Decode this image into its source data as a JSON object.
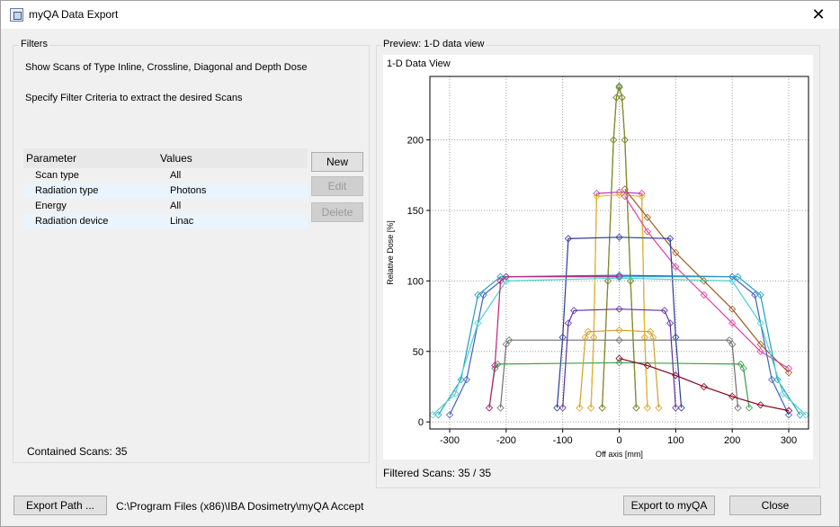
{
  "window": {
    "title": "myQA Data Export",
    "close_label": "✕"
  },
  "filters": {
    "group_label": "Filters",
    "line1": "Show Scans of Type Inline, Crossline, Diagonal and Depth Dose",
    "line2": "Specify Filter Criteria to extract the desired Scans",
    "table": {
      "headers": [
        "Parameter",
        "Values"
      ],
      "rows": [
        {
          "parameter": "Scan type",
          "value": "All"
        },
        {
          "parameter": "Radiation type",
          "value": "Photons"
        },
        {
          "parameter": "Energy",
          "value": "All"
        },
        {
          "parameter": "Radiation device",
          "value": "Linac"
        }
      ]
    },
    "buttons": {
      "new": "New",
      "edit": "Edit",
      "delete": "Delete"
    },
    "contained_scans": "Contained Scans: 35"
  },
  "preview": {
    "group_label": "Preview: 1-D data view",
    "filtered_scans": "Filtered Scans: 35 / 35"
  },
  "footer": {
    "export_path_label": "Export Path ...",
    "path": "C:\\Program Files (x86)\\IBA Dosimetry\\myQA Accept",
    "export_button": "Export to myQA",
    "close_button": "Close"
  },
  "chart_data": {
    "type": "line",
    "title": "1-D Data View",
    "xlabel": "Off axis [mm]",
    "ylabel": "Relative Dose [%]",
    "xlim": [
      -335,
      335
    ],
    "ylim": [
      -5,
      245
    ],
    "xticks": [
      -300,
      -200,
      -100,
      0,
      100,
      200,
      300
    ],
    "yticks": [
      0,
      50,
      100,
      150,
      200
    ],
    "grid": true,
    "series": [
      {
        "color": "#2a7f3a",
        "x": [
          -30,
          -20,
          -10,
          -5,
          0,
          5,
          10,
          20,
          30
        ],
        "y": [
          10,
          100,
          200,
          230,
          238,
          230,
          200,
          100,
          10
        ]
      },
      {
        "color": "#8c8a2a",
        "x": [
          -30,
          -20,
          -10,
          -5,
          0,
          5,
          10,
          20,
          30
        ],
        "y": [
          10,
          100,
          200,
          230,
          237,
          230,
          200,
          100,
          10
        ]
      },
      {
        "color": "#c040c0",
        "x": [
          -50,
          -45,
          -40,
          0,
          40,
          45,
          50
        ],
        "y": [
          10,
          60,
          162,
          163,
          162,
          60,
          10
        ]
      },
      {
        "color": "#e0c020",
        "x": [
          -50,
          -45,
          -40,
          0,
          40,
          45,
          50
        ],
        "y": [
          10,
          60,
          160,
          161,
          160,
          60,
          10
        ]
      },
      {
        "color": "#a05a20",
        "x": [
          10,
          50,
          100,
          150,
          200,
          250,
          300
        ],
        "y": [
          165,
          145,
          120,
          100,
          80,
          55,
          35
        ]
      },
      {
        "color": "#e040a0",
        "x": [
          10,
          50,
          100,
          150,
          200,
          250,
          300
        ],
        "y": [
          160,
          135,
          110,
          90,
          70,
          50,
          38
        ]
      },
      {
        "color": "#2a3a9a",
        "x": [
          -110,
          -100,
          -90,
          0,
          90,
          100,
          110
        ],
        "y": [
          10,
          60,
          130,
          131,
          130,
          60,
          10
        ]
      },
      {
        "color": "#4060c0",
        "x": [
          -300,
          -270,
          -240,
          -200,
          0,
          200,
          240,
          270,
          300
        ],
        "y": [
          5,
          30,
          90,
          103,
          104,
          103,
          90,
          30,
          5
        ]
      },
      {
        "color": "#20a0c0",
        "x": [
          -320,
          -280,
          -250,
          -210,
          0,
          210,
          250,
          280,
          320
        ],
        "y": [
          5,
          30,
          90,
          103,
          103,
          103,
          90,
          30,
          5
        ]
      },
      {
        "color": "#50d0d0",
        "x": [
          -330,
          -290,
          -250,
          -200,
          0,
          200,
          250,
          290,
          330
        ],
        "y": [
          5,
          20,
          70,
          100,
          102,
          100,
          70,
          20,
          5
        ]
      },
      {
        "color": "#707070",
        "x": [
          -210,
          -200,
          -195,
          0,
          195,
          200,
          210
        ],
        "y": [
          10,
          55,
          58,
          58,
          58,
          55,
          10
        ]
      },
      {
        "color": "#3aa04a",
        "x": [
          -230,
          -220,
          -215,
          0,
          215,
          220,
          230
        ],
        "y": [
          10,
          38,
          41,
          42,
          41,
          38,
          10
        ]
      },
      {
        "color": "#d0a020",
        "x": [
          -70,
          -60,
          -55,
          0,
          55,
          60,
          70
        ],
        "y": [
          10,
          60,
          64,
          65,
          64,
          60,
          10
        ]
      },
      {
        "color": "#6030a0",
        "x": [
          -100,
          -90,
          -80,
          0,
          80,
          90,
          100
        ],
        "y": [
          10,
          70,
          79,
          80,
          79,
          70,
          10
        ]
      },
      {
        "color": "#800020",
        "x": [
          0,
          50,
          100,
          150,
          200,
          250,
          300
        ],
        "y": [
          45,
          40,
          33,
          25,
          18,
          12,
          8
        ]
      },
      {
        "color": "#c02080",
        "x": [
          -230,
          -220,
          -210,
          -200,
          0
        ],
        "y": [
          10,
          40,
          100,
          103,
          103
        ]
      }
    ]
  }
}
